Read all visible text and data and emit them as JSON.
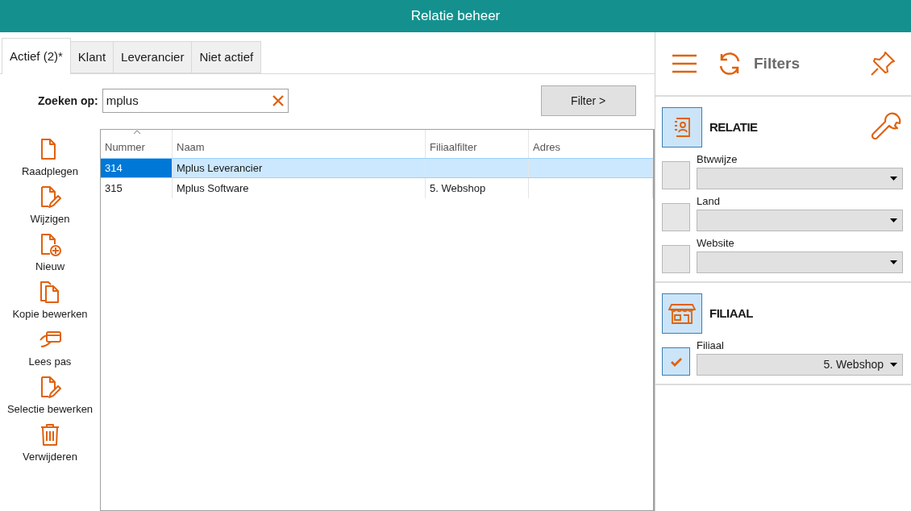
{
  "window": {
    "title": "Relatie beheer"
  },
  "tabs": [
    {
      "label": "Actief (2)*",
      "selected": true
    },
    {
      "label": "Klant",
      "selected": false
    },
    {
      "label": "Leverancier",
      "selected": false
    },
    {
      "label": "Niet actief",
      "selected": false
    }
  ],
  "search": {
    "label": "Zoeken op:",
    "value": "mplus"
  },
  "filter_button": "Filter >",
  "actions": [
    {
      "kind": "view",
      "label": "Raadplegen"
    },
    {
      "kind": "edit",
      "label": "Wijzigen"
    },
    {
      "kind": "new",
      "label": "Nieuw"
    },
    {
      "kind": "copy",
      "label": "Kopie bewerken"
    },
    {
      "kind": "card",
      "label": "Lees pas"
    },
    {
      "kind": "edit",
      "label": "Selectie bewerken"
    },
    {
      "kind": "delete",
      "label": "Verwijderen"
    }
  ],
  "table": {
    "columns": [
      {
        "label": "Nummer",
        "sorted": true
      },
      {
        "label": "Naam",
        "sorted": false
      },
      {
        "label": "Filiaalfilter",
        "sorted": false
      },
      {
        "label": "Adres",
        "sorted": false
      }
    ],
    "rows": [
      {
        "cells": [
          "314",
          "Mplus Leverancier",
          "",
          ""
        ],
        "selected": true
      },
      {
        "cells": [
          "315",
          "Mplus Software",
          "5. Webshop",
          ""
        ],
        "selected": false
      }
    ]
  },
  "filters": {
    "title": "Filters",
    "sections": [
      {
        "kind": "relation",
        "title": "RELATIE",
        "tool": true,
        "fields": [
          {
            "label": "Btwwijze",
            "checked": false
          },
          {
            "label": "Land",
            "checked": false
          },
          {
            "label": "Website",
            "checked": false
          }
        ]
      },
      {
        "kind": "store",
        "title": "FILIAAL",
        "tool": false,
        "fields": [
          {
            "label": "Filiaal",
            "value": "5. Webshop",
            "checked": true
          }
        ]
      }
    ]
  }
}
